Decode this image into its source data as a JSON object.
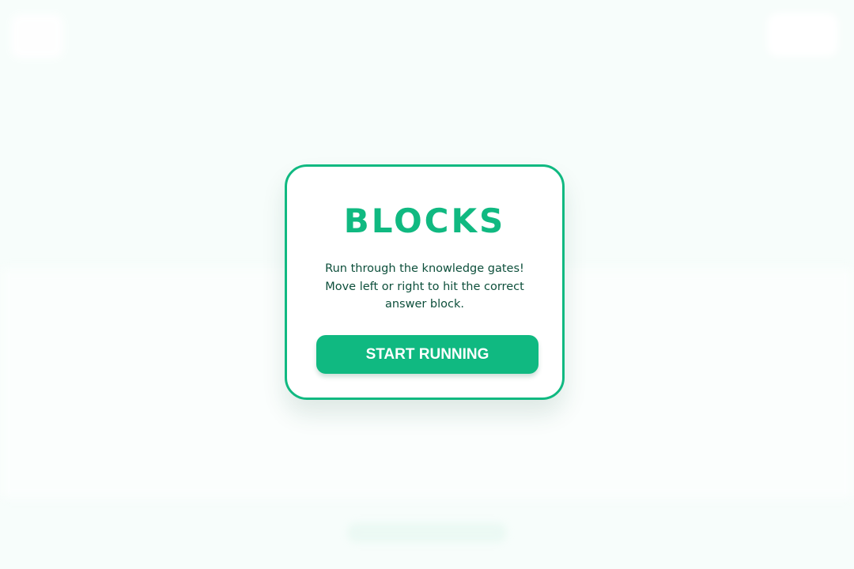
{
  "game": {
    "title": "BLOCKS",
    "description": "Run through the knowledge gates! Move left or right to hit the correct answer block.",
    "start_label": "START RUNNING"
  },
  "colors": {
    "accent": "#10b981",
    "text_dark": "#0d4f3b",
    "background": "#f7fdfb"
  }
}
